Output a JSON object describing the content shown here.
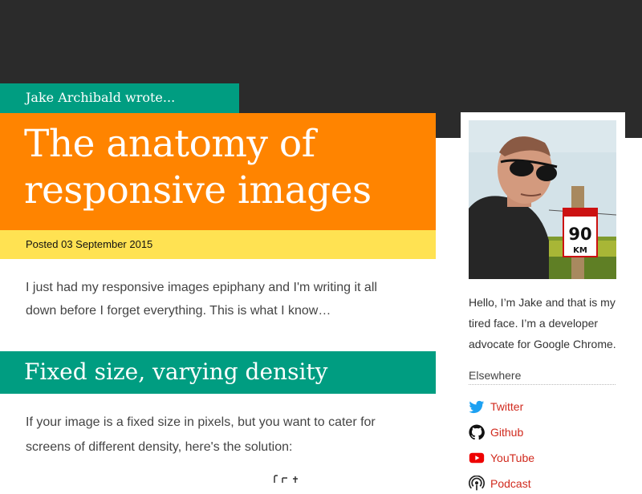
{
  "header": {
    "author_line": "Jake Archibald wrote..."
  },
  "article": {
    "title": "The anatomy of responsive images",
    "title_line1": "The anatomy of",
    "title_line2": "responsive images",
    "posted": "Posted 03 September 2015",
    "intro": "I just had my responsive images epiphany and I'm writing it all down before I forget everything. This is what I know…",
    "section_heading": "Fixed size, varying density",
    "section_text": "If your image is a fixed size in pixels, but you want to cater for screens of different density, here's the solution:"
  },
  "sidebar": {
    "photo_icon": "author-photo",
    "bio": "Hello, I’m Jake and that is my tired face. I’m a developer advocate for Google Chrome.",
    "elsewhere_heading": "Elsewhere",
    "links": [
      {
        "label": "Twitter",
        "icon": "twitter-icon"
      },
      {
        "label": "Github",
        "icon": "github-icon"
      },
      {
        "label": "YouTube",
        "icon": "youtube-icon"
      },
      {
        "label": "Podcast",
        "icon": "podcast-icon"
      }
    ]
  },
  "colors": {
    "top_band": "#2b2b2b",
    "teal": "#009d81",
    "orange": "#ff8400",
    "yellow": "#ffe252",
    "link": "#d12a1e"
  }
}
